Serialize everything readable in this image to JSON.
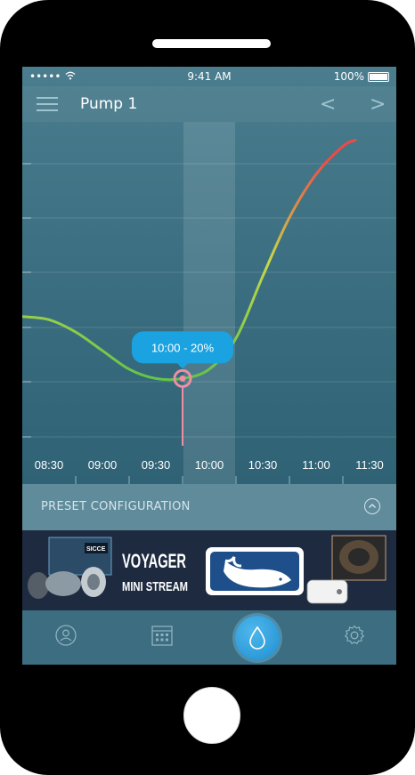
{
  "status_bar": {
    "signal": "•••••",
    "time": "9:41 AM",
    "battery": "100%"
  },
  "nav": {
    "title": "Pump 1"
  },
  "chart_data": {
    "type": "line",
    "x": [
      "08:30",
      "08:45",
      "09:00",
      "09:15",
      "09:30",
      "09:45",
      "10:00",
      "10:15",
      "10:30",
      "10:45",
      "11:00",
      "11:15",
      "11:30",
      "11:37"
    ],
    "values": [
      40,
      39,
      35,
      29,
      23,
      20,
      20,
      23,
      33,
      53,
      72,
      86,
      95,
      97
    ],
    "tick_labels": [
      "08:30",
      "09:00",
      "09:30",
      "10:00",
      "10:30",
      "11:00",
      "11:30"
    ],
    "ylim": [
      0,
      100
    ],
    "grid": true,
    "selected": {
      "x": "10:00",
      "value": 20,
      "label": "10:00 - 20%"
    },
    "colors": {
      "low": "#5cc24a",
      "mid": "#c6d84a",
      "high": "#ef4a45",
      "marker": "#ef8fa3",
      "tooltip": "#1aa3e0"
    }
  },
  "preset": {
    "label": "PRESET CONFIGURATION"
  },
  "ad": {
    "line1": "VOYAGER",
    "line2": "MINI STREAM",
    "brand": "SICCE"
  },
  "tabs": {
    "items": [
      "profile-icon",
      "calendar-icon",
      "water-drop-icon",
      "settings-icon"
    ]
  }
}
